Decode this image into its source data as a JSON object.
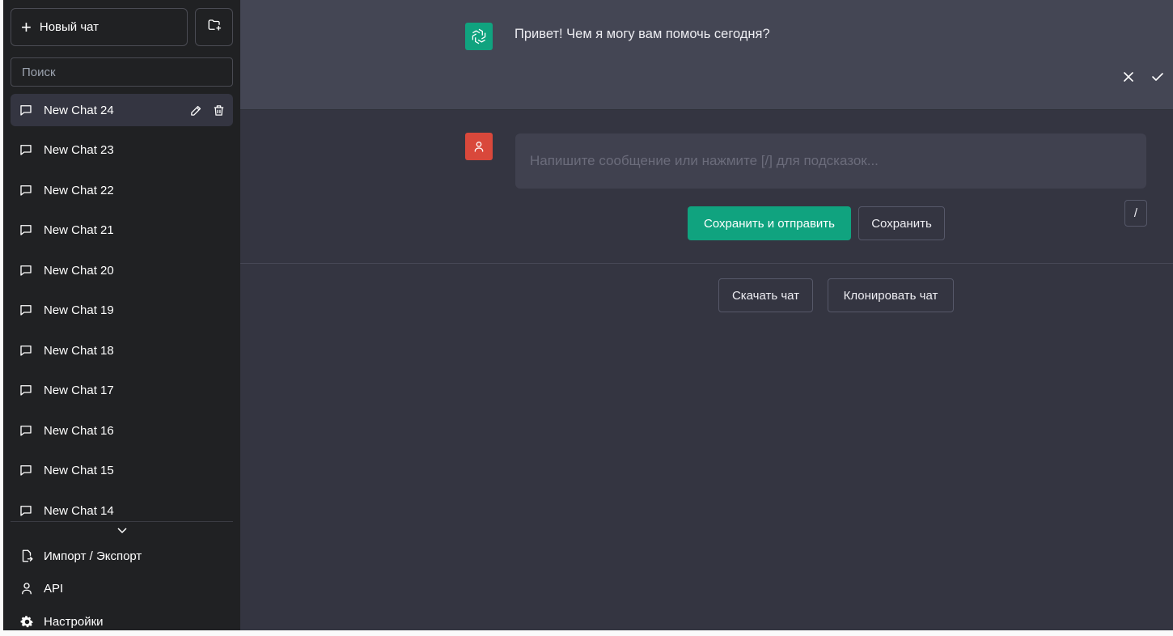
{
  "sidebar": {
    "new_chat_label": "Новый чат",
    "search_placeholder": "Поиск",
    "chats": [
      {
        "label": "New Chat 24",
        "active": true
      },
      {
        "label": "New Chat 23"
      },
      {
        "label": "New Chat 22"
      },
      {
        "label": "New Chat 21"
      },
      {
        "label": "New Chat 20"
      },
      {
        "label": "New Chat 19"
      },
      {
        "label": "New Chat 18"
      },
      {
        "label": "New Chat 17"
      },
      {
        "label": "New Chat 16"
      },
      {
        "label": "New Chat 15"
      },
      {
        "label": "New Chat 14"
      }
    ],
    "import_export_label": "Импорт / Экспорт",
    "api_label": "API",
    "settings_label": "Настройки"
  },
  "conversation": {
    "assistant_message": "Привет! Чем я могу вам помочь сегодня?",
    "input_placeholder": "Напишите сообщение или нажмите [/] для подсказок...",
    "slash_label": "/",
    "save_send_label": "Сохранить и отправить",
    "save_label": "Сохранить",
    "download_label": "Скачать чат",
    "clone_label": "Клонировать чат"
  },
  "colors": {
    "sidebar_bg": "#202123",
    "main_bg": "#343541",
    "assistant_bg": "#444654",
    "accent": "#10a37f",
    "user_avatar": "#d9483b"
  }
}
